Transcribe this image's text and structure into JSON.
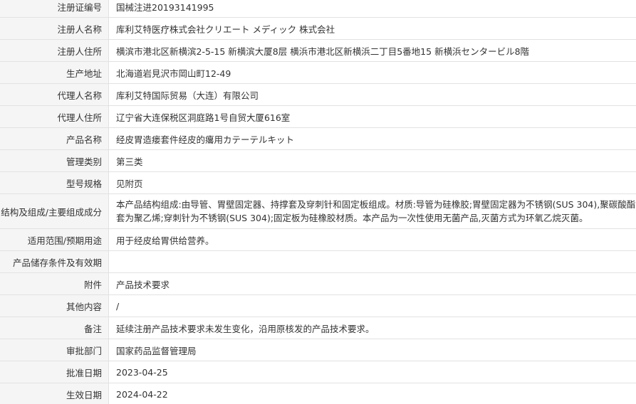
{
  "rows": [
    {
      "label": "注册证编号",
      "value": "国械注进20193141995"
    },
    {
      "label": "注册人名称",
      "value": "库利艾特医疗株式会社クリエート メディック 株式会社"
    },
    {
      "label": "注册人住所",
      "value": "横滨市港北区新横滨2-5-15 新横滨大厦8层 横浜市港北区新横浜二丁目5番地15 新横浜センタービル8階"
    },
    {
      "label": "生产地址",
      "value": "北海道岩見沢市岡山町12-49"
    },
    {
      "label": "代理人名称",
      "value": "库利艾特国际贸易（大连）有限公司"
    },
    {
      "label": "代理人住所",
      "value": "辽宁省大连保税区洞庭路1号自贸大厦616室"
    },
    {
      "label": "产品名称",
      "value": "经皮胃造瘘套件经皮的癟用カテーテルキット"
    },
    {
      "label": "管理类别",
      "value": "第三类"
    },
    {
      "label": "型号规格",
      "value": "见附页"
    },
    {
      "label": "结构及组成/主要组成成分",
      "value": "本产品结构组成:由导管、胃壁固定器、持撑套及穿刺针和固定板组成。材质:导管为硅橡胶;胃壁固定器为不锈钢(SUS 304),聚碳酸酯;持撑套为聚乙烯;穿刺针为不锈钢(SUS 304);固定板为硅橡胶材质。本产品为一次性使用无菌产品,灭菌方式为环氧乙烷灭菌。"
    },
    {
      "label": "适用范围/预期用途",
      "value": "用于经皮给胃供给营养。"
    },
    {
      "label": "产品储存条件及有效期",
      "value": ""
    },
    {
      "label": "附件",
      "value": "产品技术要求"
    },
    {
      "label": "其他内容",
      "value": "/"
    },
    {
      "label": "备注",
      "value": "延续注册产品技术要求未发生变化，沿用原核发的产品技术要求。"
    },
    {
      "label": "审批部门",
      "value": "国家药品监督管理局"
    },
    {
      "label": "批准日期",
      "value": "2023-04-25"
    },
    {
      "label": "生效日期",
      "value": "2024-04-22"
    }
  ]
}
